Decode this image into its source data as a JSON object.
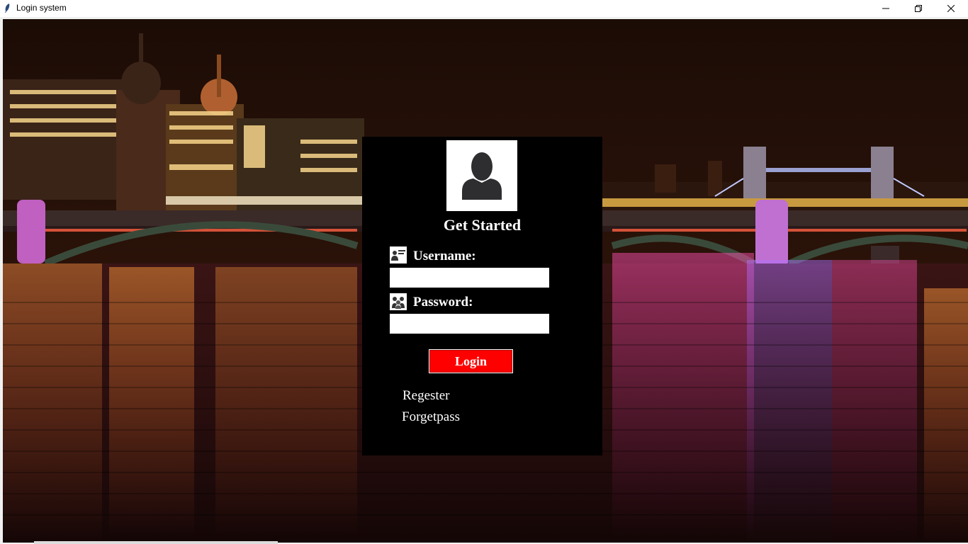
{
  "window": {
    "title": "Login system",
    "icons": {
      "app": "feather-icon",
      "minimize": "minimize-icon",
      "maximize": "restore-icon",
      "close": "close-icon"
    }
  },
  "panel": {
    "title": "Get Started",
    "avatar_icon": "user-avatar-icon",
    "username": {
      "label": "Username:",
      "icon": "user-card-icon",
      "value": ""
    },
    "password": {
      "label": "Password:",
      "icon": "users-group-icon",
      "value": ""
    },
    "login_label": "Login",
    "register_label": "Regester",
    "forget_label": "Forgetpass"
  },
  "colors": {
    "panel_bg": "#000000",
    "login_button": "#ff0000",
    "text": "#ffffff"
  }
}
